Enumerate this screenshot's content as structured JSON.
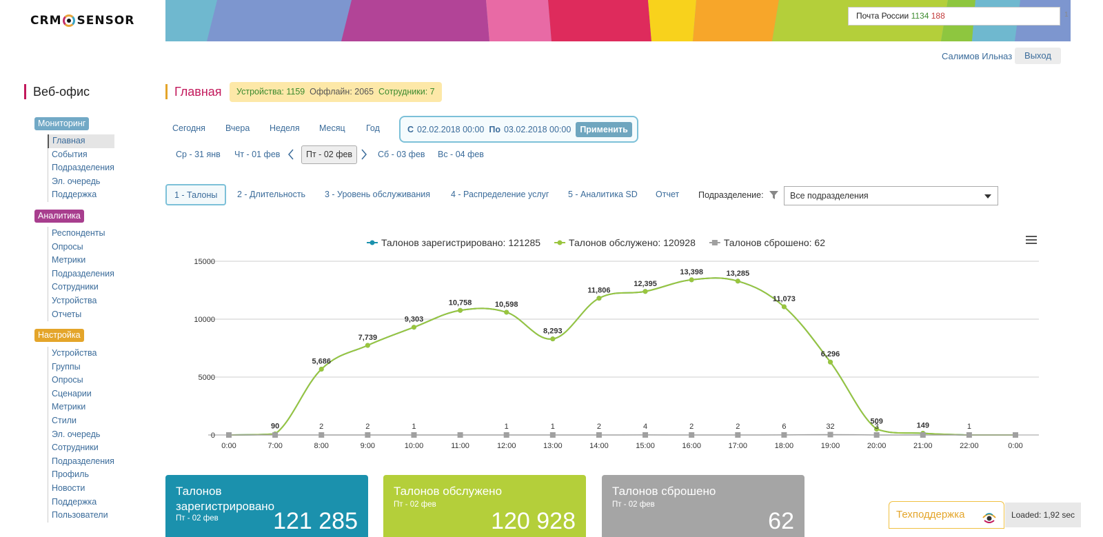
{
  "header": {
    "logo_left": "CRM",
    "logo_right": "SENSOR",
    "org_name": "Почта России",
    "org_id_a": "1134",
    "org_id_b": "188",
    "corner_num": "1",
    "user": "Салимов Ильназ",
    "logout": "Выход"
  },
  "sidebar": {
    "title": "Веб-офис",
    "sections": [
      {
        "label": "Мониторинг",
        "items": [
          "Главная",
          "События",
          "Подразделения",
          "Эл. очередь",
          "Поддержка"
        ]
      },
      {
        "label": "Аналитика",
        "items": [
          "Респонденты",
          "Опросы",
          "Метрики",
          "Подразделения",
          "Сотрудники",
          "Устройства",
          "Отчеты"
        ]
      },
      {
        "label": "Настройка",
        "items": [
          "Устройства",
          "Группы",
          "Опросы",
          "Сценарии",
          "Метрики",
          "Стили",
          "Эл. очередь",
          "Сотрудники",
          "Подразделения",
          "Профиль",
          "Новости",
          "Поддержка",
          "Пользователи"
        ]
      }
    ]
  },
  "main": {
    "title": "Главная",
    "stats": {
      "devices_label": "Устройства: 1159",
      "offline_label": "Оффлайн: 2065",
      "staff_label": "Сотрудники: 7"
    },
    "periods": [
      "Сегодня",
      "Вчера",
      "Неделя",
      "Месяц",
      "Год"
    ],
    "range": {
      "from_label": "С",
      "from_value": "02.02.2018 00:00",
      "to_label": "По",
      "to_value": "03.02.2018 00:00",
      "apply": "Применить"
    },
    "days": {
      "prev2": "Ср - 31 янв",
      "prev1": "Чт - 01 фев",
      "current": "Пт - 02 фев",
      "next1": "Сб - 03 фев",
      "next2": "Вс - 04 фев"
    },
    "tabs": [
      "1 - Талоны",
      "2 - Длительность",
      "3 - Уровень обслуживания",
      "4 - Распределение услуг",
      "5 - Аналитика SD",
      "Отчет"
    ],
    "subdivision_label": "Подразделение:",
    "subdivision_value": "Все подразделения"
  },
  "chart_data": {
    "type": "line",
    "x": [
      "0:00",
      "7:00",
      "8:00",
      "9:00",
      "10:00",
      "11:00",
      "12:00",
      "13:00",
      "14:00",
      "15:00",
      "16:00",
      "17:00",
      "18:00",
      "19:00",
      "20:00",
      "21:00",
      "22:00",
      "0:00"
    ],
    "ylim": [
      0,
      15000
    ],
    "yticks": [
      "0",
      "5000",
      "10000",
      "15000"
    ],
    "grid": true,
    "legend_position": "top-center",
    "series": [
      {
        "name": "Талонов зарегистрировано: 121285",
        "color": "#1b91ad",
        "values": [
          0,
          90,
          5686,
          7739,
          9303,
          10758,
          10598,
          8293,
          11806,
          12395,
          13398,
          13285,
          11073,
          6296,
          509,
          149,
          0,
          0
        ]
      },
      {
        "name": "Талонов обслужено: 120928",
        "color": "#9ac53e",
        "values": [
          0,
          90,
          5686,
          7739,
          9303,
          10758,
          10598,
          8293,
          11806,
          12395,
          13398,
          13285,
          11073,
          6296,
          509,
          149,
          0,
          0
        ]
      },
      {
        "name": "Талонов сброшено: 62",
        "color": "#a0a0a0",
        "values": [
          0,
          0,
          2,
          2,
          1,
          0,
          1,
          1,
          2,
          4,
          2,
          2,
          6,
          32,
          3,
          0,
          1,
          0
        ]
      }
    ],
    "labels_main": [
      "",
      "90",
      "5,686",
      "7,739",
      "9,303",
      "10,758",
      "10,598",
      "8,293",
      "11,806",
      "12,395",
      "13,398",
      "13,285",
      "11,073",
      "6,296",
      "509",
      "149",
      "",
      ""
    ],
    "labels_drop": [
      "",
      "",
      "2",
      "2",
      "1",
      "",
      "1",
      "1",
      "2",
      "4",
      "2",
      "2",
      "6",
      "32",
      "3",
      "",
      "1",
      ""
    ]
  },
  "cards": [
    {
      "title": "Талонов зарегистрировано",
      "sub": "Пт - 02 фев",
      "value": "121 285",
      "color": "#1b91ad"
    },
    {
      "title": "Талонов обслужено",
      "sub": "Пт - 02 фев",
      "value": "120 928",
      "color": "#b4cf3a"
    },
    {
      "title": "Талонов сброшено",
      "sub": "Пт - 02 фев",
      "value": "62",
      "color": "#a5a5a5"
    }
  ],
  "footer": {
    "support": "Техподдержка",
    "loaded": "Loaded: 1,92 sec"
  }
}
